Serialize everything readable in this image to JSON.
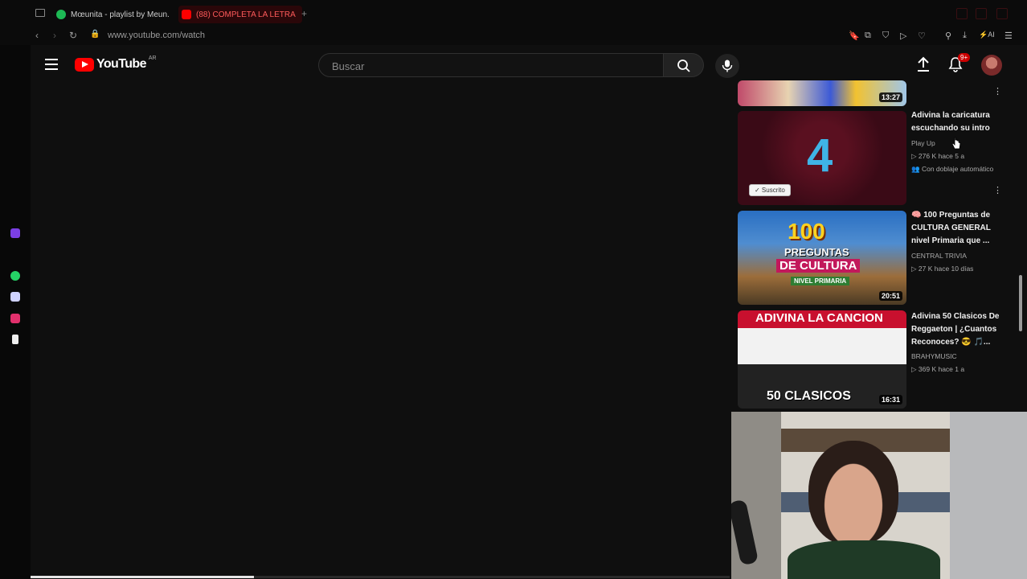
{
  "browser": {
    "tabs": [
      {
        "title": "Mœunita - playlist by Meun...",
        "favicon_color": "#1db954",
        "active": false
      },
      {
        "title": "(88) COMPLETA LA LETRA",
        "favicon_color": "#ff0000",
        "active": true
      }
    ],
    "new_tab_label": "+",
    "url": "www.youtube.com/watch",
    "ai_label": "AI"
  },
  "youtube": {
    "logo_text": "YouTube",
    "country_code": "AR",
    "search_placeholder": "Buscar",
    "notification_count": "9+"
  },
  "recommendations": [
    {
      "title": "",
      "channel": "",
      "duration": "13:27",
      "partial": true
    },
    {
      "title": "Adivina la caricatura escuchando su intro",
      "channel": "Play Up",
      "meta": "▷ 276 K  hace 5 a",
      "extra": "Con doblaje automático",
      "thumb_big_text": "4",
      "subscribed_label": "✓ Suscrito",
      "thumb_color": "#3a0a16"
    },
    {
      "title": "🧠 100 Preguntas de CULTURA GENERAL nivel Primaria que ...",
      "channel": "CENTRAL TRIVIA",
      "meta": "▷ 27 K  hace 10 días",
      "duration": "20:51",
      "thumb_lines": [
        "100",
        "PREGUNTAS",
        "DE CULTURA",
        "NIVEL PRIMARIA"
      ]
    },
    {
      "title": "Adivina 50 Clasicos De Reggaeton | ¿Cuantos Reconoces? 😎 🎵...",
      "channel": "BRAHYMUSIC",
      "meta": "▷ 369 K  hace 1 a",
      "duration": "16:31",
      "thumb_lines": [
        "ADIVINA LA CANCION",
        "50 CLASICOS"
      ]
    }
  ],
  "player": {
    "progress_fraction": 0.32
  },
  "colors": {
    "accent": "#ff0000",
    "background": "#0f0f0f"
  }
}
